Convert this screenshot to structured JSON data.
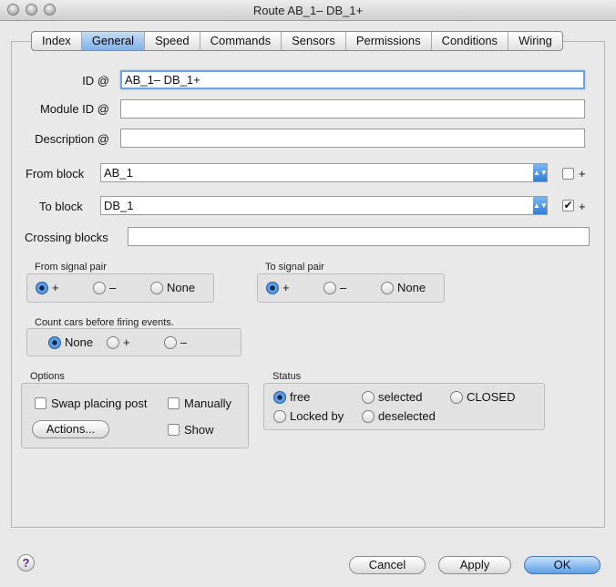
{
  "window": {
    "title": "Route AB_1– DB_1+"
  },
  "tabs": [
    {
      "label": "Index"
    },
    {
      "label": "General",
      "active": true
    },
    {
      "label": "Speed"
    },
    {
      "label": "Commands"
    },
    {
      "label": "Sensors"
    },
    {
      "label": "Permissions"
    },
    {
      "label": "Conditions"
    },
    {
      "label": "Wiring"
    }
  ],
  "form": {
    "id_label": "ID @",
    "id_value": "AB_1– DB_1+",
    "module_id_label": "Module ID @",
    "module_id_value": "",
    "description_label": "Description @",
    "description_value": "",
    "from_block_label": "From block",
    "from_block_value": "AB_1",
    "from_block_plus_label": "+",
    "from_block_plus_checked": false,
    "to_block_label": "To block",
    "to_block_value": "DB_1",
    "to_block_plus_label": "+",
    "to_block_plus_checked": true,
    "crossing_blocks_label": "Crossing blocks",
    "crossing_blocks_value": ""
  },
  "from_signal_pair": {
    "title": "From signal pair",
    "options": [
      "+",
      "–",
      "None"
    ],
    "selected": "+"
  },
  "to_signal_pair": {
    "title": "To signal pair",
    "options": [
      "+",
      "–",
      "None"
    ],
    "selected": "+"
  },
  "count_cars": {
    "title": "Count cars before firing events.",
    "options": [
      "None",
      "+",
      "–"
    ],
    "selected": "None"
  },
  "options_group": {
    "title": "Options",
    "swap_placing_post": "Swap placing post",
    "manually": "Manually",
    "actions_button": "Actions...",
    "show": "Show"
  },
  "status_group": {
    "title": "Status",
    "options": [
      "free",
      "selected",
      "CLOSED",
      "Locked by",
      "deselected"
    ],
    "selected": "free"
  },
  "footer": {
    "help": "?",
    "cancel": "Cancel",
    "apply": "Apply",
    "ok": "OK"
  },
  "colors": {
    "accent": "#4a8fde",
    "window_bg": "#e8e8e8"
  }
}
